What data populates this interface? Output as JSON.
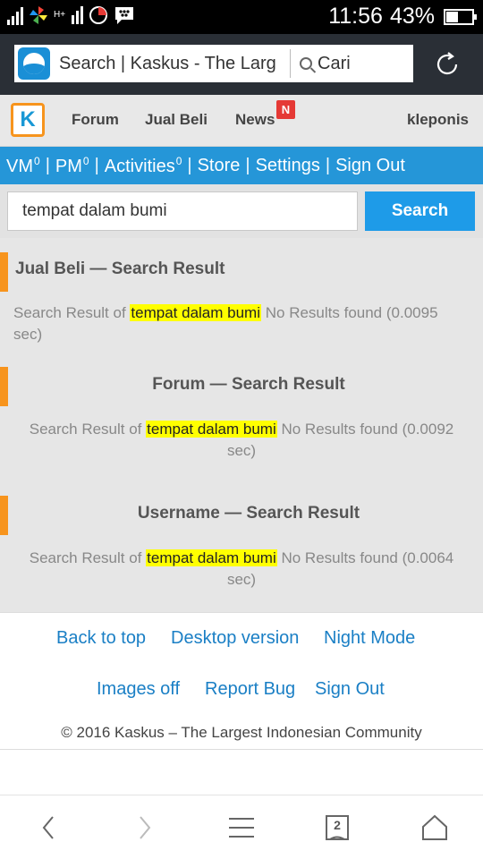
{
  "status_bar": {
    "time": "11:56",
    "battery_percent": "43%",
    "battery_level": 0.43,
    "network_label": "H+"
  },
  "browser": {
    "url_text": "Search | Kaskus - The Larg",
    "search_label": "Cari"
  },
  "nav": {
    "logo_letter": "K",
    "items": [
      "Forum",
      "Jual Beli",
      "News"
    ],
    "news_badge": "N",
    "username": "kleponis"
  },
  "userbar": {
    "vm_label": "VM",
    "vm_count": "0",
    "pm_label": "PM",
    "pm_count": "0",
    "activities_label": "Activities",
    "activities_count": "0",
    "store": "Store",
    "settings": "Settings",
    "signout": "Sign Out"
  },
  "search": {
    "value": "tempat dalam bumi",
    "button": "Search"
  },
  "results": [
    {
      "title": "Jual Beli — Search Result",
      "prefix": "Search Result of",
      "query": "tempat dalam bumi",
      "suffix": "No Results found (0.0095",
      "line2": "sec)"
    },
    {
      "title": "Forum — Search Result",
      "prefix": "Search Result of",
      "query": "tempat dalam bumi",
      "suffix": "No Results found (0.0092",
      "line2": "sec)"
    },
    {
      "title": "Username — Search Result",
      "prefix": "Search Result of",
      "query": "tempat dalam bumi",
      "suffix": "No Results found (0.0064",
      "line2": "sec)"
    }
  ],
  "footer": {
    "links_row1": [
      "Back to top",
      "Desktop version",
      "Night Mode"
    ],
    "links_row2": [
      "Images off",
      "Report Bug",
      "Sign Out"
    ],
    "copyright": "© 2016 Kaskus – The Largest Indonesian Community"
  },
  "bottom_nav": {
    "tab_count": "2"
  },
  "colors": {
    "accent_blue": "#2596d8",
    "orange": "#f7941d",
    "highlight": "#ffff00",
    "link": "#1a7fc5"
  }
}
